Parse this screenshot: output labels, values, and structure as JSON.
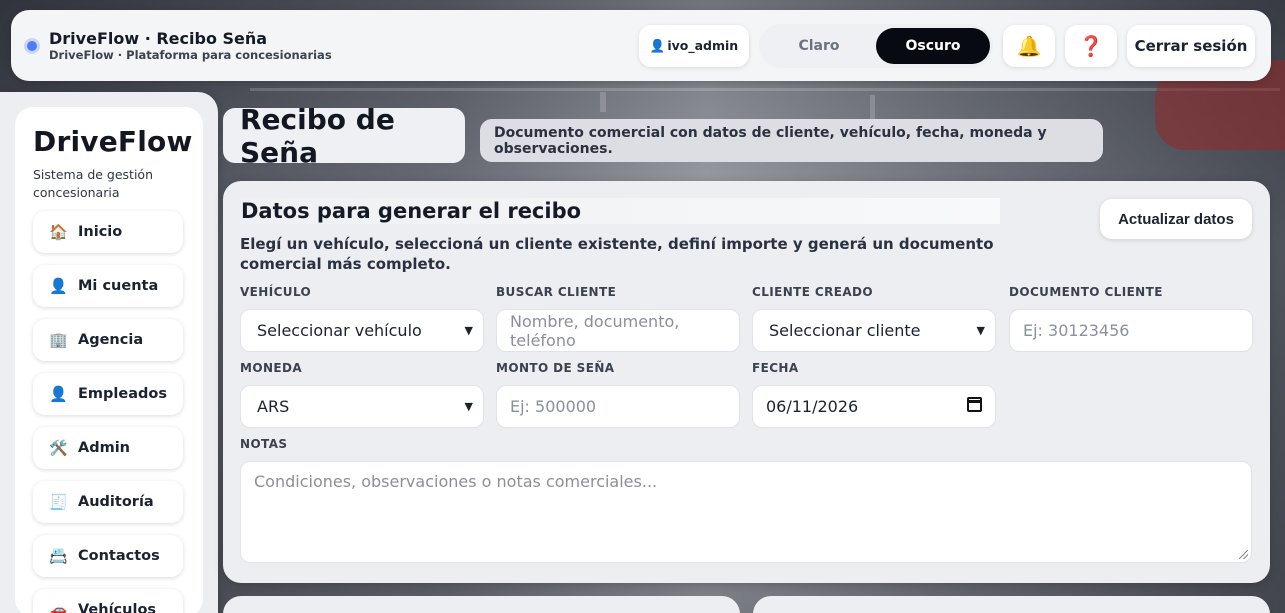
{
  "topbar": {
    "title": "DriveFlow · Recibo Seña",
    "subtitle": "DriveFlow · Plataforma para concesionarias",
    "user": "ivo_admin",
    "user_icon": "👤",
    "theme_light": "Claro",
    "theme_dark": "Oscuro",
    "bell_icon": "🔔",
    "help_icon": "❓",
    "logout": "Cerrar sesión"
  },
  "sidebar": {
    "brand": "DriveFlow",
    "subtitle": "Sistema de gestión concesionaria",
    "items": [
      {
        "icon": "🏠",
        "label": "Inicio"
      },
      {
        "icon": "👤",
        "label": "Mi cuenta"
      },
      {
        "icon": "🏢",
        "label": "Agencia"
      },
      {
        "icon": "👤",
        "label": "Empleados"
      },
      {
        "icon": "🛠️",
        "label": "Admin"
      },
      {
        "icon": "🧾",
        "label": "Auditoría"
      },
      {
        "icon": "📇",
        "label": "Contactos"
      },
      {
        "icon": "🚗",
        "label": "Vehículos"
      }
    ]
  },
  "page": {
    "title": "Recibo de Seña",
    "description": "Documento comercial con datos de cliente, vehículo, fecha, moneda y observaciones."
  },
  "form": {
    "title": "Datos para generar el recibo",
    "lead": "Elegí un vehículo, seleccioná un cliente existente, definí importe y generá un documento comercial más completo.",
    "refresh": "Actualizar datos",
    "vehiculo": {
      "label": "VEHÍCULO",
      "value": "Seleccionar vehículo"
    },
    "buscar": {
      "label": "BUSCAR CLIENTE",
      "placeholder": "Nombre, documento, teléfono"
    },
    "cliente": {
      "label": "CLIENTE CREADO",
      "value": "Seleccionar cliente"
    },
    "documento": {
      "label": "DOCUMENTO CLIENTE",
      "placeholder": "Ej: 30123456"
    },
    "moneda": {
      "label": "MONEDA",
      "value": "ARS"
    },
    "monto": {
      "label": "MONTO DE SEÑA",
      "placeholder": "Ej: 500000"
    },
    "fecha": {
      "label": "FECHA",
      "value": "06/11/2026"
    },
    "notas": {
      "label": "NOTAS",
      "placeholder": "Condiciones, observaciones o notas comerciales..."
    }
  }
}
